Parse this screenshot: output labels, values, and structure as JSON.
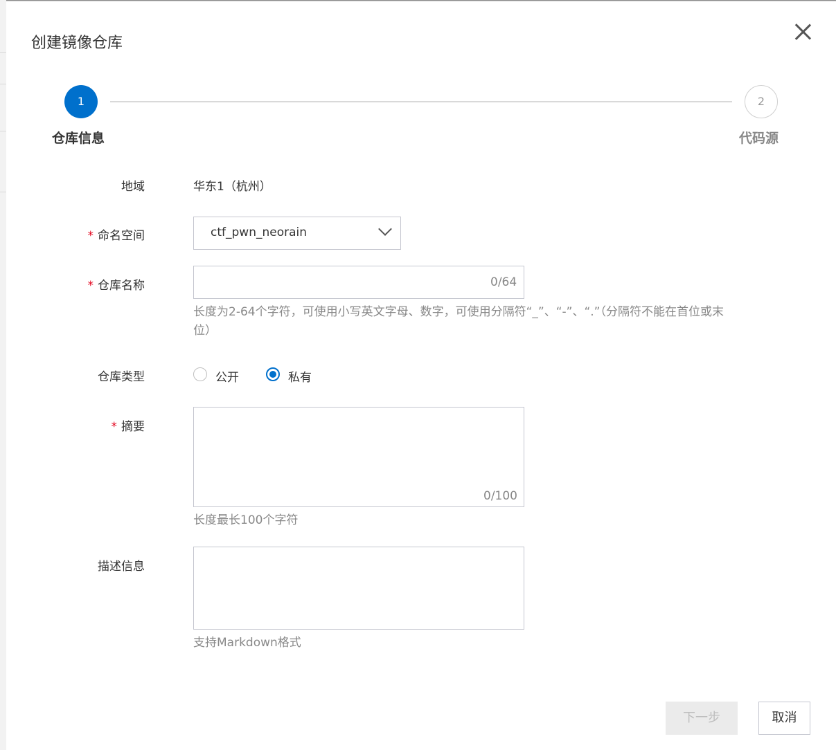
{
  "dialog": {
    "title": "创建镜像仓库",
    "close_icon": "close-icon"
  },
  "steps": [
    {
      "number": "1",
      "title": "仓库信息",
      "active": true
    },
    {
      "number": "2",
      "title": "代码源",
      "active": false
    }
  ],
  "form": {
    "region": {
      "label": "地域",
      "value": "华东1（杭州）"
    },
    "namespace": {
      "label": "命名空间",
      "required": "*",
      "value": "ctf_pwn_neorain",
      "icon": "chevron-down-icon"
    },
    "repo_name": {
      "label": "仓库名称",
      "required": "*",
      "value": "",
      "counter": "0/64",
      "help_line1": "长度为2-64个字符，可使用小写英文字母、数字，可使用分隔符“_”、“-”、“.”（分隔符不能在首位或末",
      "help_line2": "位）"
    },
    "repo_type": {
      "label": "仓库类型",
      "options": [
        {
          "label": "公开",
          "checked": false
        },
        {
          "label": "私有",
          "checked": true
        }
      ]
    },
    "summary": {
      "label": "摘要",
      "required": "*",
      "value": "",
      "counter": "0/100",
      "help": "长度最长100个字符"
    },
    "description": {
      "label": "描述信息",
      "value": "",
      "help": "支持Markdown格式"
    }
  },
  "footer": {
    "next_label": "下一步",
    "cancel_label": "取消"
  },
  "colors": {
    "primary": "#0070cc",
    "required": "#e2001a",
    "disabled_bg": "#ebebeb"
  }
}
